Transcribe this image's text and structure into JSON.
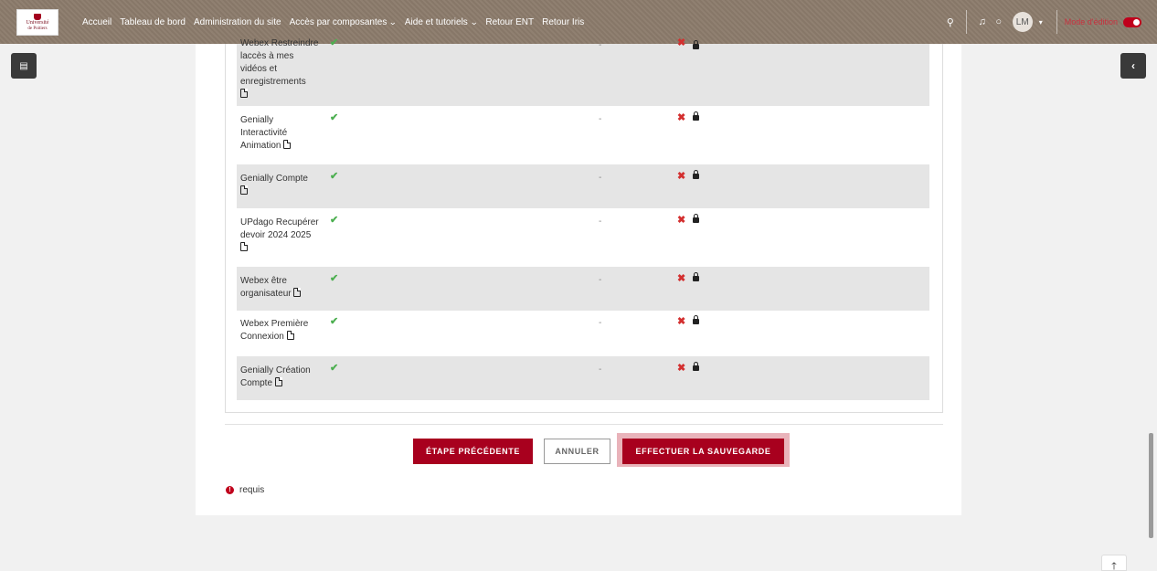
{
  "logo": {
    "line1": "Université",
    "line2": "de Poitiers"
  },
  "nav": {
    "items": [
      {
        "label": "Accueil",
        "dropdown": false
      },
      {
        "label": "Tableau de bord",
        "dropdown": false
      },
      {
        "label": "Administration du site",
        "dropdown": false
      },
      {
        "label": "Accès par composantes",
        "dropdown": true
      },
      {
        "label": "Aide et tutoriels",
        "dropdown": true
      },
      {
        "label": "Retour ENT",
        "dropdown": false
      },
      {
        "label": "Retour Iris",
        "dropdown": false
      }
    ],
    "avatar_initials": "LM",
    "edit_mode_label": "Mode d'édition",
    "edit_mode_on": true
  },
  "rows": [
    {
      "name": "Webex Restreindre laccès à mes vidéos et enregistrements",
      "included": "✔",
      "value": "-",
      "excluded": "✖"
    },
    {
      "name": "Genially Interactivité Animation",
      "included": "✔",
      "value": "-",
      "excluded": "✖"
    },
    {
      "name": "Genially Compte",
      "included": "✔",
      "value": "-",
      "excluded": "✖"
    },
    {
      "name": "UPdago Recupérer devoir 2024 2025",
      "included": "✔",
      "value": "-",
      "excluded": "✖"
    },
    {
      "name": "Webex être organisateur",
      "included": "✔",
      "value": "-",
      "excluded": "✖"
    },
    {
      "name": "Webex Première Connexion",
      "included": "✔",
      "value": "-",
      "excluded": "✖"
    },
    {
      "name": "Genially Création Compte",
      "included": "✔",
      "value": "-",
      "excluded": "✖"
    }
  ],
  "buttons": {
    "previous": "ÉTAPE PRÉCÉDENTE",
    "cancel": "ANNULER",
    "save": "EFFECTUER LA SAUVEGARDE"
  },
  "required_label": "requis",
  "colors": {
    "brand": "#a8001e",
    "navbar": "#8b7b6b",
    "check": "#4caf50",
    "cross": "#d32f2f"
  }
}
